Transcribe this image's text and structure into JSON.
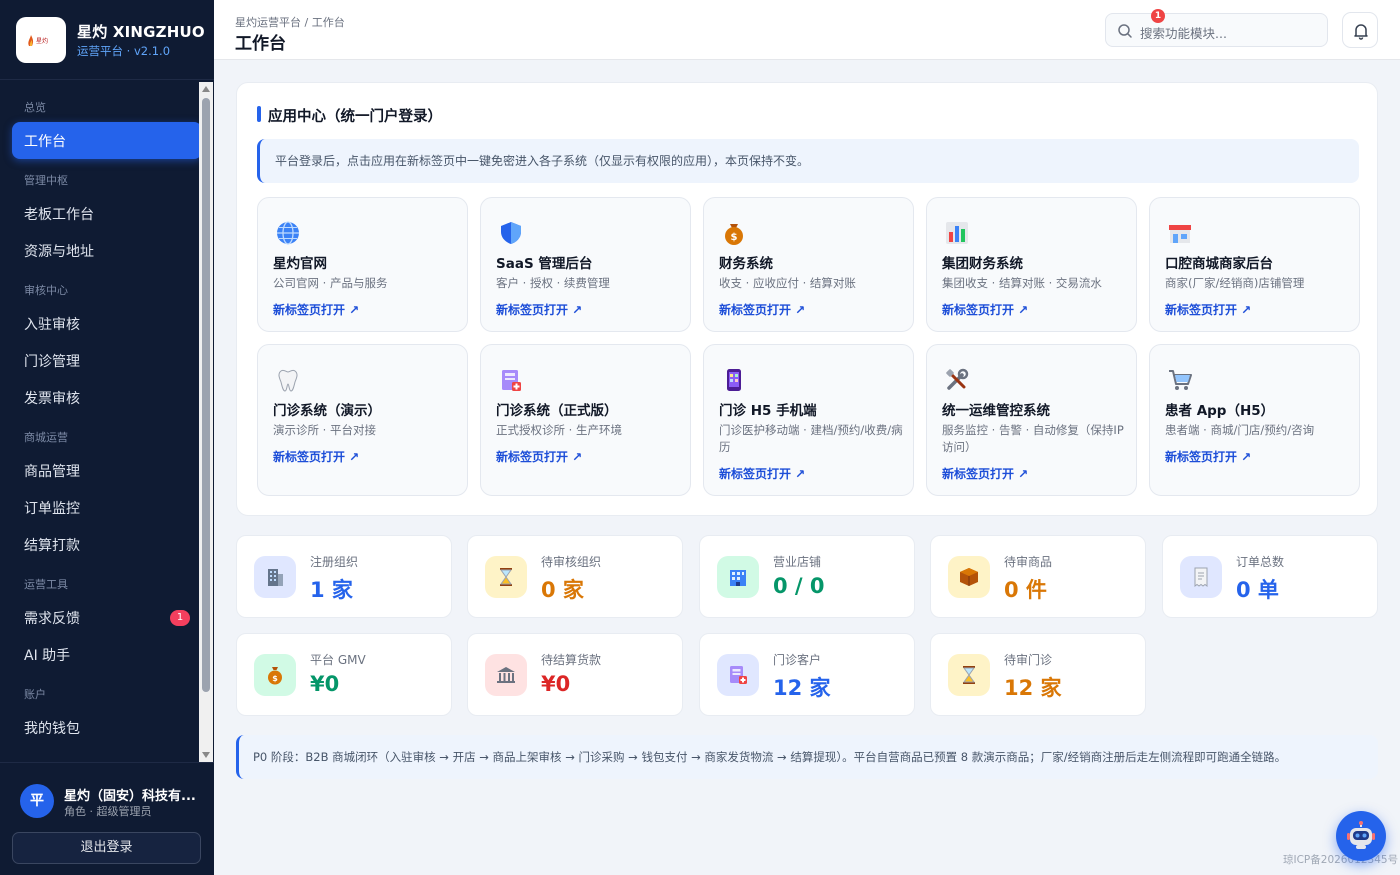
{
  "brand": {
    "name": "星灼 XINGZHUO",
    "sub": "运营平台 · v2.1.0",
    "logo_text": "星灼"
  },
  "nav": {
    "groups": [
      {
        "label": "总览",
        "items": [
          {
            "label": "工作台",
            "active": true
          }
        ]
      },
      {
        "label": "管理中枢",
        "items": [
          {
            "label": "老板工作台"
          },
          {
            "label": "资源与地址"
          }
        ]
      },
      {
        "label": "审核中心",
        "items": [
          {
            "label": "入驻审核"
          },
          {
            "label": "门诊管理"
          },
          {
            "label": "发票审核"
          }
        ]
      },
      {
        "label": "商城运营",
        "items": [
          {
            "label": "商品管理"
          },
          {
            "label": "订单监控"
          },
          {
            "label": "结算打款"
          }
        ]
      },
      {
        "label": "运营工具",
        "items": [
          {
            "label": "需求反馈",
            "badge": "1"
          },
          {
            "label": "AI 助手"
          }
        ]
      },
      {
        "label": "账户",
        "items": [
          {
            "label": "我的钱包"
          }
        ]
      }
    ]
  },
  "user": {
    "avatar": "平",
    "name": "星灼（固安）科技有...",
    "role": "角色 · 超级管理员",
    "logout": "退出登录"
  },
  "header": {
    "breadcrumb": "星灼运营平台 / 工作台",
    "title": "工作台",
    "search_placeholder": "搜索功能模块...",
    "notif_count": "1"
  },
  "app_center": {
    "title": "应用中心（统一门户登录）",
    "notice": "平台登录后，点击应用在新标签页中一键免密进入各子系统（仅显示有权限的应用），本页保持不变。",
    "apps": [
      {
        "name": "星灼官网",
        "desc": "公司官网 · 产品与服务",
        "link": "新标签页打开 ↗",
        "icon": "globe-icon"
      },
      {
        "name": "SaaS 管理后台",
        "desc": "客户 · 授权 · 续费管理",
        "link": "新标签页打开 ↗",
        "icon": "shield-icon"
      },
      {
        "name": "财务系统",
        "desc": "收支 · 应收应付 · 结算对账",
        "link": "新标签页打开 ↗",
        "icon": "money-bag-icon"
      },
      {
        "name": "集团财务系统",
        "desc": "集团收支 · 结算对账 · 交易流水",
        "link": "新标签页打开 ↗",
        "icon": "bar-chart-icon"
      },
      {
        "name": "口腔商城商家后台",
        "desc": "商家(厂家/经销商)店铺管理",
        "link": "新标签页打开 ↗",
        "icon": "store-icon"
      },
      {
        "name": "门诊系统（演示）",
        "desc": "演示诊所 · 平台对接",
        "link": "新标签页打开 ↗",
        "icon": "tooth-icon"
      },
      {
        "name": "门诊系统（正式版）",
        "desc": "正式授权诊所 · 生产环境",
        "link": "新标签页打开 ↗",
        "icon": "clinic-icon"
      },
      {
        "name": "门诊 H5 手机端",
        "desc": "门诊医护移动端 · 建档/预约/收费/病历",
        "link": "新标签页打开 ↗",
        "icon": "phone-icon"
      },
      {
        "name": "统一运维管控系统",
        "desc": "服务监控 · 告警 · 自动修复（保持IP访问）",
        "link": "新标签页打开 ↗",
        "icon": "tools-icon"
      },
      {
        "name": "患者 App（H5）",
        "desc": "患者端 · 商城/门店/预约/咨询",
        "link": "新标签页打开 ↗",
        "icon": "cart-icon"
      }
    ]
  },
  "stats": [
    {
      "label": "注册组织",
      "value": "1 家",
      "color": "#2563eb",
      "icon": "building-icon"
    },
    {
      "label": "待审核组织",
      "value": "0 家",
      "color": "#d97706",
      "icon": "hourglass-icon"
    },
    {
      "label": "营业店铺",
      "value": "0 / 0",
      "color": "#059669",
      "icon": "shop-building-icon"
    },
    {
      "label": "待审商品",
      "value": "0 件",
      "color": "#d97706",
      "icon": "package-icon"
    },
    {
      "label": "订单总数",
      "value": "0 单",
      "color": "#2563eb",
      "icon": "receipt-icon"
    },
    {
      "label": "平台 GMV",
      "value": "¥0",
      "color": "#059669",
      "icon": "money-bag-icon"
    },
    {
      "label": "待结算货款",
      "value": "¥0",
      "color": "#dc2626",
      "icon": "bank-icon"
    },
    {
      "label": "门诊客户",
      "value": "12 家",
      "color": "#2563eb",
      "icon": "clinic-icon"
    },
    {
      "label": "待审门诊",
      "value": "12 家",
      "color": "#d97706",
      "icon": "hourglass-icon"
    }
  ],
  "footnote": "P0 阶段：B2B 商城闭环（入驻审核 → 开店 → 商品上架审核 → 门诊采购 → 钱包支付 → 商家发货物流 → 结算提现）。平台自营商品已预置 8 款演示商品；厂家/经销商注册后走左侧流程即可跑通全链路。",
  "icp": "琼ICP备2026012345号"
}
